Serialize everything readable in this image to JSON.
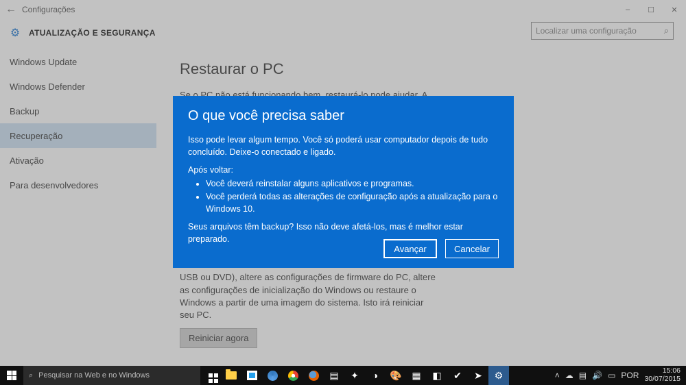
{
  "window": {
    "title": "Configurações",
    "minimize": "–",
    "maximize": "☐",
    "close": "✕"
  },
  "header": {
    "title": "ATUALIZAÇÃO E SEGURANÇA",
    "search_placeholder": "Localizar uma configuração"
  },
  "sidebar": {
    "items": [
      {
        "label": "Windows Update"
      },
      {
        "label": "Windows Defender"
      },
      {
        "label": "Backup"
      },
      {
        "label": "Recuperação"
      },
      {
        "label": "Ativação"
      },
      {
        "label": "Para desenvolvedores"
      }
    ],
    "selected_index": 3
  },
  "main": {
    "heading": "Restaurar o PC",
    "para1": "Se o PC não está funcionando bem, restaurá-lo pode ajudar. A restauração permite escolher entre manter ou remover arquivos e",
    "para2": "USB ou DVD), altere as configurações de firmware do PC, altere as configurações de inicialização do Windows ou restaure o Windows a partir de uma imagem do sistema. Isto irá reiniciar seu PC.",
    "restart_btn": "Reiniciar agora"
  },
  "dialog": {
    "title": "O que você precisa saber",
    "line1": "Isso pode levar algum tempo. Você só poderá usar computador depois de tudo concluído. Deixe-o conectado e ligado.",
    "after_label": "Após voltar:",
    "bullet1": "Você deverá reinstalar alguns aplicativos e programas.",
    "bullet2": "Você perderá todas as alterações de configuração após a atualização para o Windows 10.",
    "line3": "Seus arquivos têm backup? Isso não deve afetá-los, mas é melhor estar preparado.",
    "next": "Avançar",
    "cancel": "Cancelar"
  },
  "taskbar": {
    "search_placeholder": "Pesquisar na Web e no Windows",
    "lang": "POR",
    "time": "15:06",
    "date": "30/07/2015"
  }
}
